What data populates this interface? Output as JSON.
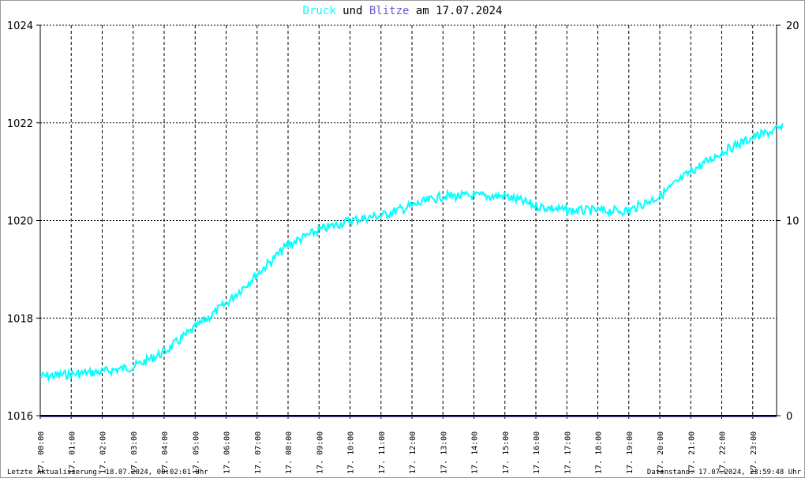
{
  "title": {
    "part1": "Druck",
    "part2": "und",
    "part3": "Blitze",
    "part4": "am 17.07.2024",
    "color1": "#00ffff",
    "color3": "#6a5acd"
  },
  "footer": {
    "left": "Letzte Aktualisierung: 18.07.2024, 00:02:01 Uhr",
    "right": "Datenstand: 17.07.2024, 23:59:48 Uhr"
  },
  "chart_data": {
    "type": "line",
    "title": "Druck und Blitze am 17.07.2024",
    "x_ticks": [
      "17. 00:00",
      "17. 01:00",
      "17. 02:00",
      "17. 03:00",
      "17. 04:00",
      "17. 05:00",
      "17. 06:00",
      "17. 07:00",
      "17. 08:00",
      "17. 09:00",
      "17. 10:00",
      "17. 11:00",
      "17. 12:00",
      "17. 13:00",
      "17. 14:00",
      "17. 15:00",
      "17. 16:00",
      "17. 17:00",
      "17. 18:00",
      "17. 19:00",
      "17. 20:00",
      "17. 21:00",
      "17. 22:00",
      "17. 23:00"
    ],
    "y_left": {
      "range": [
        1016,
        1024
      ],
      "ticks": [
        "1016",
        "1018",
        "1020",
        "1022",
        "1024"
      ]
    },
    "y_right": {
      "range": [
        0,
        20
      ],
      "ticks": [
        "0",
        "10",
        "20"
      ]
    },
    "grid": true,
    "series": [
      {
        "name": "Druck",
        "color": "#00ffff",
        "x_hours": [
          0,
          1,
          2,
          3,
          4,
          5,
          6,
          7,
          8,
          9,
          10,
          11,
          12,
          13,
          14,
          15,
          16,
          17,
          18,
          19,
          20,
          21,
          22,
          23,
          23.98
        ],
        "values": [
          1016.8,
          1016.85,
          1016.9,
          1017.0,
          1017.3,
          1017.8,
          1018.3,
          1018.9,
          1019.5,
          1019.8,
          1020.0,
          1020.1,
          1020.3,
          1020.5,
          1020.5,
          1020.5,
          1020.3,
          1020.2,
          1020.2,
          1020.2,
          1020.5,
          1021.0,
          1021.4,
          1021.7,
          1021.9
        ]
      },
      {
        "name": "Blitze",
        "color": "#6a5acd",
        "x_hours": [
          0,
          23.98
        ],
        "values": [
          0,
          0
        ]
      }
    ]
  }
}
